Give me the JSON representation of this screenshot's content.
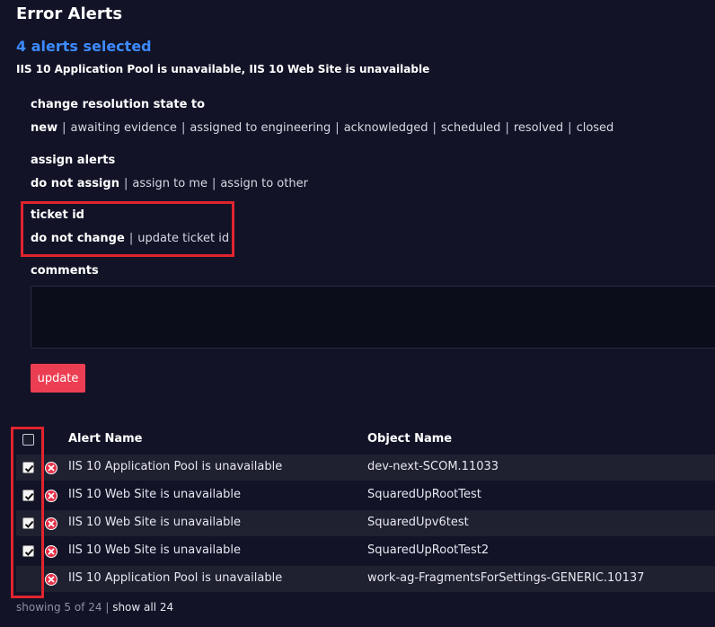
{
  "page": {
    "title": "Error Alerts",
    "selected_count": "4 alerts selected",
    "selected_names": "IIS 10 Application Pool is unavailable, IIS 10 Web Site is unavailable"
  },
  "resolution": {
    "label": "change resolution state to",
    "options": [
      "new",
      "awaiting evidence",
      "assigned to engineering",
      "acknowledged",
      "scheduled",
      "resolved",
      "closed"
    ]
  },
  "assign": {
    "label": "assign alerts",
    "options": [
      "do not assign",
      "assign to me",
      "assign to other"
    ]
  },
  "ticket": {
    "label": "ticket id",
    "options": [
      "do not change",
      "update ticket id"
    ]
  },
  "comments": {
    "label": "comments",
    "value": ""
  },
  "update_button": "update",
  "table": {
    "headers": {
      "alert_name": "Alert Name",
      "object_name": "Object Name"
    },
    "rows": [
      {
        "alert": "IIS 10 Application Pool is unavailable",
        "object": "dev-next-SCOM.11033",
        "checked": true,
        "icon": "error-icon"
      },
      {
        "alert": "IIS 10 Web Site is unavailable",
        "object": "SquaredUpRootTest",
        "checked": true,
        "icon": "error-icon"
      },
      {
        "alert": "IIS 10 Web Site is unavailable",
        "object": "SquaredUpv6test",
        "checked": true,
        "icon": "error-icon"
      },
      {
        "alert": "IIS 10 Web Site is unavailable",
        "object": "SquaredUpRootTest2",
        "checked": true,
        "icon": "error-icon"
      },
      {
        "alert": "IIS 10 Application Pool is unavailable",
        "object": "work-ag-FragmentsForSettings-GENERIC.10137",
        "checked": false,
        "icon": "error-icon"
      }
    ]
  },
  "footer": {
    "showing": "showing 5 of 24",
    "separator": "|",
    "show_all": "show all 24"
  },
  "colors": {
    "background": "#121327",
    "accent_blue": "#3d8bff",
    "button_red": "#ec3e52",
    "highlight_red": "#e0242e",
    "error_red": "#e4314a"
  }
}
